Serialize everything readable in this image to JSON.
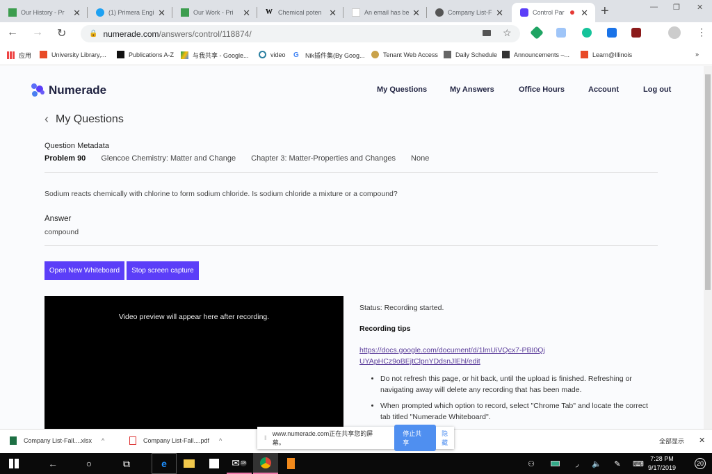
{
  "browser": {
    "tabs": [
      {
        "title": "Our History - Pr",
        "icon": "sheets-icon",
        "active": false
      },
      {
        "title": "(1) Primera Engi",
        "icon": "twitter-icon",
        "active": false
      },
      {
        "title": "Our Work - Pri",
        "icon": "sheets-icon",
        "active": false
      },
      {
        "title": "Chemical poten",
        "icon": "wikipedia-icon",
        "active": false
      },
      {
        "title": "An email has be",
        "icon": "blank-page-icon",
        "active": false
      },
      {
        "title": "Company List-F",
        "icon": "globe-icon",
        "active": false
      },
      {
        "title": "Control Par",
        "icon": "numerade-icon",
        "active": true,
        "recording": true
      }
    ],
    "new_tab": "+",
    "url_host": "numerade.com",
    "url_path": "/answers/control/118874/",
    "bookmarks": [
      {
        "label": "应用",
        "icon": "apps-grid-icon"
      },
      {
        "label": "University Library,...",
        "icon": "illinois-icon"
      },
      {
        "label": "Publications A-Z",
        "icon": "w-icon"
      },
      {
        "label": "与我共享 - Google...",
        "icon": "drive-icon"
      },
      {
        "label": "video",
        "icon": "video-icon"
      },
      {
        "label": "Nik插件集(By Goog...",
        "icon": "google-icon"
      },
      {
        "label": "Tenant Web Access",
        "icon": "tenant-icon"
      },
      {
        "label": "Daily Schedule",
        "icon": "schedule-icon"
      },
      {
        "label": "Announcements –...",
        "icon": "announcements-icon"
      },
      {
        "label": "Learn@Illinois",
        "icon": "illinois-icon"
      }
    ],
    "more": "»"
  },
  "site": {
    "brand": "Numerade",
    "nav": [
      "My Questions",
      "My Answers",
      "Office Hours",
      "Account",
      "Log out"
    ],
    "back_label": "My Questions",
    "metadata_heading": "Question Metadata",
    "metadata": {
      "problem": "Problem 90",
      "book": "Glencoe Chemistry: Matter and Change",
      "chapter": "Chapter 3: Matter-Properties and Changes",
      "section": "None"
    },
    "question": "Sodium reacts chemically with chlorine to form sodium chloride. Is sodium chloride a mixture or a compound?",
    "answer_heading": "Answer",
    "answer": "compound",
    "buttons": {
      "whiteboard": "Open New Whiteboard",
      "stop": "Stop screen capture"
    },
    "video_placeholder": "Video preview will appear here after recording.",
    "status": "Status: Recording started.",
    "tips_heading": "Recording tips",
    "tips_link": "https://docs.google.com/document/d/1lmUiVQcx7-PBI0QjUYApHCz9oBEjtClpnYDdsnJlEhl/edit",
    "tips": [
      "Do not refresh this page, or hit back, until the upload is finished. Refreshing or navigating away will delete any recording that has been made.",
      "When prompted which option to record, select \"Chrome Tab\" and locate the correct tab titled \"Numerade Whiteboard\"."
    ],
    "accent": "#5b3ef8"
  },
  "downloads": {
    "items": [
      {
        "name": "Company List-Fall....xlsx",
        "icon": "excel-icon"
      },
      {
        "name": "Company List-Fall....pdf",
        "icon": "pdf-icon"
      }
    ],
    "show_all": "全部显示",
    "close": "✕"
  },
  "share_bar": {
    "message": "www.numerade.com正在共享您的屏幕。",
    "stop": "停止共享",
    "hide": "隐藏"
  },
  "taskbar": {
    "time": "7:28 PM",
    "date": "9/17/2019",
    "mail_badge": "18",
    "notifications": "20"
  }
}
